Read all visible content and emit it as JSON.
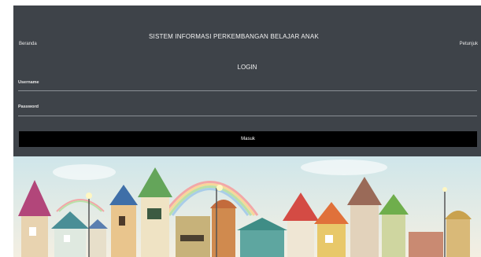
{
  "header": {
    "title": "SISTEM INFORMASI PERKEMBANGAN BELAJAR ANAK",
    "nav_left": "Beranda",
    "nav_right": "Petunjuk"
  },
  "login": {
    "title": "LOGIN",
    "username_label": "Username",
    "username_value": "",
    "password_label": "Password",
    "password_value": "",
    "submit_label": "Masuk"
  },
  "colors": {
    "panel": "#3e4349",
    "button": "#000000"
  }
}
